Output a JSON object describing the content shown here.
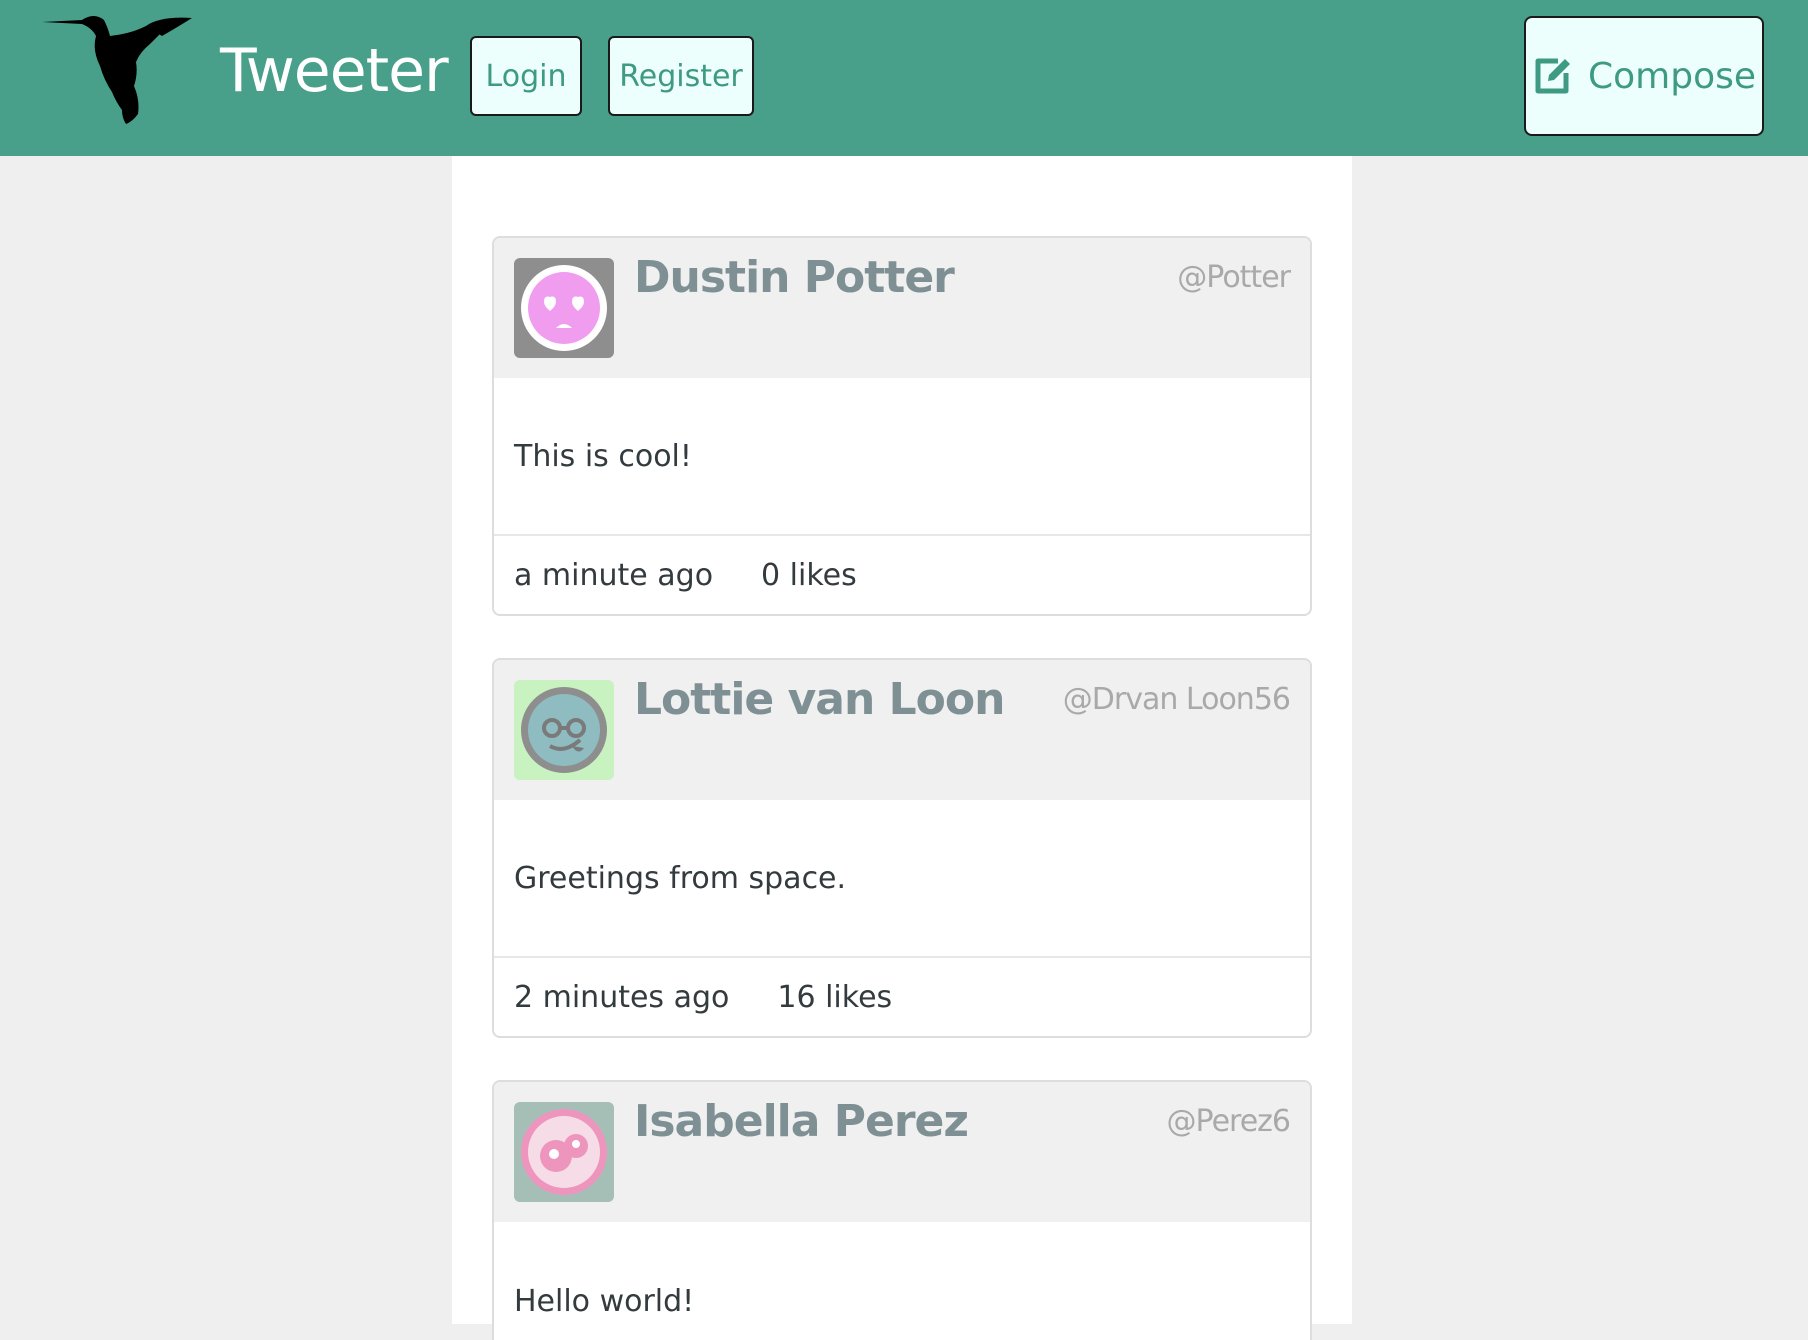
{
  "app": {
    "title": "Tweeter"
  },
  "header": {
    "login_label": "Login",
    "register_label": "Register",
    "compose_label": "Compose"
  },
  "colors": {
    "accent": "#489f8a",
    "button_bg": "#ecfffd",
    "button_text": "#3e9a83",
    "page_bg": "#efefef"
  },
  "tweets": [
    {
      "name": "Dustin Potter",
      "handle": "@Potter",
      "text": "This is cool!",
      "time": "a minute ago",
      "likes": "0 likes",
      "avatar_icon": "heart-eyes-face-icon"
    },
    {
      "name": "Lottie van Loon",
      "handle": "@Drvan Loon56",
      "text": "Greetings from space.",
      "time": "2 minutes ago",
      "likes": "16 likes",
      "avatar_icon": "nerd-face-icon"
    },
    {
      "name": "Isabella Perez",
      "handle": "@Perez6",
      "text": "Hello world!",
      "avatar_icon": "bubble-face-icon"
    }
  ]
}
